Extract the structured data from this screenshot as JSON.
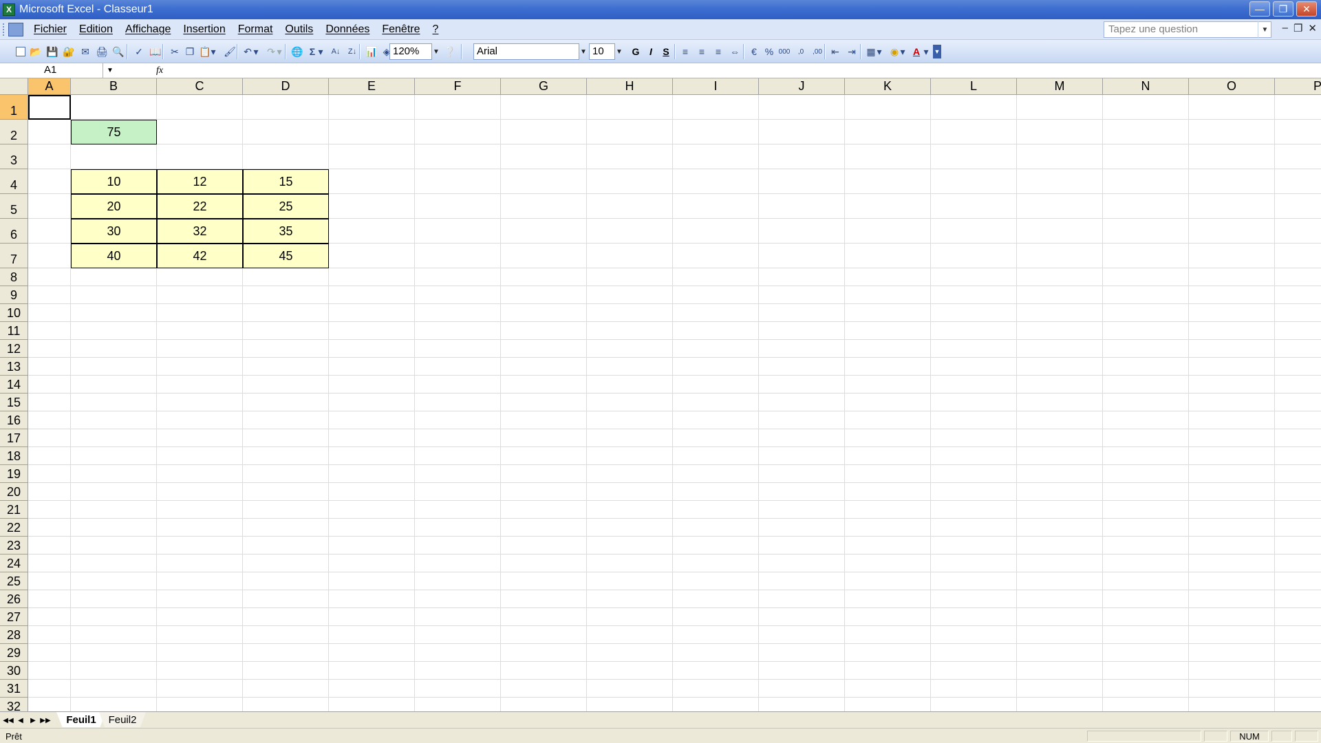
{
  "window": {
    "title": "Microsoft Excel - Classeur1",
    "app_icon": "excel-icon"
  },
  "menu": {
    "items": [
      "Fichier",
      "Edition",
      "Affichage",
      "Insertion",
      "Format",
      "Outils",
      "Données",
      "Fenêtre",
      "?"
    ],
    "question_placeholder": "Tapez une question"
  },
  "toolbar": {
    "zoom": "120%",
    "font": "Arial",
    "font_size": "10",
    "bold": "G",
    "italic": "I",
    "underline": "S"
  },
  "formula": {
    "name_box": "A1",
    "fx": "fx",
    "content": ""
  },
  "sheet": {
    "columns": [
      "A",
      "B",
      "C",
      "D",
      "E",
      "F",
      "G",
      "H",
      "I",
      "J",
      "K",
      "L",
      "M",
      "N",
      "O",
      "P"
    ],
    "rows": [
      "1",
      "2",
      "3",
      "4",
      "5",
      "6",
      "7",
      "8",
      "9",
      "10",
      "11",
      "12",
      "13",
      "14",
      "15",
      "16",
      "17",
      "18",
      "19",
      "20",
      "21",
      "22",
      "23",
      "24",
      "25",
      "26",
      "27",
      "28",
      "29",
      "30",
      "31",
      "32"
    ],
    "active_cell": "A1",
    "cells": [
      {
        "ref": "B2",
        "value": "75",
        "fill": "green"
      },
      {
        "ref": "B4",
        "value": "10",
        "fill": "yellow"
      },
      {
        "ref": "C4",
        "value": "12",
        "fill": "yellow"
      },
      {
        "ref": "D4",
        "value": "15",
        "fill": "yellow"
      },
      {
        "ref": "B5",
        "value": "20",
        "fill": "yellow"
      },
      {
        "ref": "C5",
        "value": "22",
        "fill": "yellow"
      },
      {
        "ref": "D5",
        "value": "25",
        "fill": "yellow"
      },
      {
        "ref": "B6",
        "value": "30",
        "fill": "yellow"
      },
      {
        "ref": "C6",
        "value": "32",
        "fill": "yellow"
      },
      {
        "ref": "D6",
        "value": "35",
        "fill": "yellow"
      },
      {
        "ref": "B7",
        "value": "40",
        "fill": "yellow"
      },
      {
        "ref": "C7",
        "value": "42",
        "fill": "yellow"
      },
      {
        "ref": "D7",
        "value": "45",
        "fill": "yellow"
      }
    ],
    "colors": {
      "green": "#c6f0c6",
      "yellow": "#ffffc8",
      "header_active": "#f9c46b"
    }
  },
  "tabs": [
    "Feuil1",
    "Feuil2"
  ],
  "active_tab": "Feuil1",
  "status": {
    "text": "Prêt",
    "num": "NUM"
  }
}
